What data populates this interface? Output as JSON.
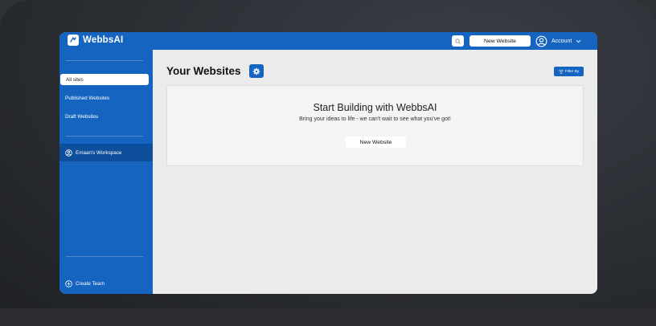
{
  "brand": {
    "name": "WebbsAI",
    "color": "#1565c0"
  },
  "topbar": {
    "search_icon": "search-icon",
    "new_website_label": "New Website",
    "account_label": "Account",
    "account_icon": "user-circle-icon",
    "dropdown_icon": "chevron-down-icon"
  },
  "sidebar": {
    "items": [
      {
        "label": "All sites",
        "active": true
      },
      {
        "label": "Published Websites",
        "active": false
      },
      {
        "label": "Draft Websites",
        "active": false
      }
    ],
    "workspace": {
      "label": "Emaan's Workspace",
      "icon": "user-circle-icon"
    },
    "create_team": {
      "label": "Create Team",
      "icon": "plus-circle-icon"
    }
  },
  "main": {
    "title": "Your Websites",
    "settings_icon": "gear-icon",
    "filter_label": "Filter By",
    "filter_icon": "filter-icon",
    "empty_state": {
      "title": "Start Building with WebbsAI",
      "subtitle": "Bring your ideas to life - we can't wait to see what you've got!",
      "button_label": "New Website"
    }
  }
}
